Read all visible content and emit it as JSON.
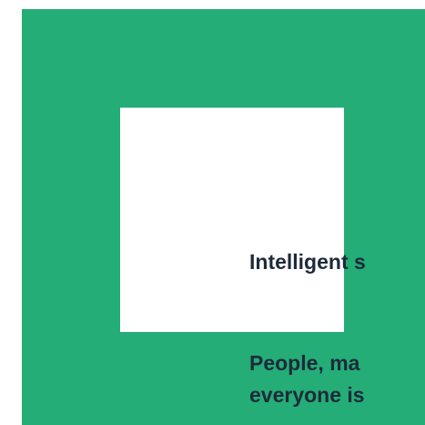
{
  "hero": {
    "heading": "Intelligent s",
    "body_lines": [
      "People, ma",
      "everyone is"
    ]
  },
  "colors": {
    "panel_background": "#24ad77",
    "image_placeholder": "#ffffff",
    "text": "#1e2a3a"
  }
}
